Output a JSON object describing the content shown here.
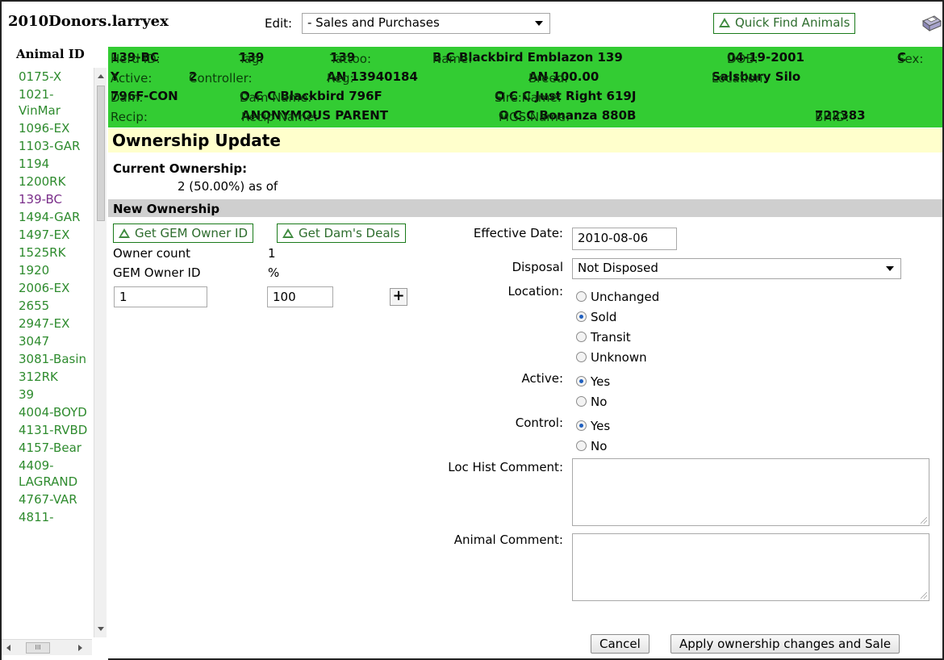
{
  "window": {
    "title": "2010Donors.larryex"
  },
  "toolbar": {
    "edit_label": "Edit:",
    "edit_value": "- Sales and Purchases",
    "quick_find_label": "Quick Find Animals"
  },
  "sidebar": {
    "header": "Animal ID",
    "items": [
      {
        "label": "0175-X"
      },
      {
        "label": "1021-VinMar"
      },
      {
        "label": "1096-EX"
      },
      {
        "label": "1103-GAR"
      },
      {
        "label": "1194"
      },
      {
        "label": "1200RK"
      },
      {
        "label": "139-BC"
      },
      {
        "label": "1494-GAR"
      },
      {
        "label": "1497-EX"
      },
      {
        "label": "1525RK"
      },
      {
        "label": "1920"
      },
      {
        "label": "2006-EX"
      },
      {
        "label": "2655"
      },
      {
        "label": "2947-EX"
      },
      {
        "label": "3047"
      },
      {
        "label": "3081-Basin"
      },
      {
        "label": "312RK"
      },
      {
        "label": "39"
      },
      {
        "label": "4004-BOYD"
      },
      {
        "label": "4131-RVBD"
      },
      {
        "label": "4157-Bear"
      },
      {
        "label": "4409-LAGRAND"
      },
      {
        "label": "4767-VAR"
      },
      {
        "label": "4811-"
      }
    ]
  },
  "animal": {
    "herd_id_label": "Herd ID:",
    "herd_id": "139-BC",
    "tag_label": "Tag:",
    "tag": "139",
    "tattoo_label": "Tattoo:",
    "tattoo": "139",
    "name_label": "Name:",
    "name": "B C Blackbird Emblazon 139",
    "dob_label": "DOB:",
    "dob": "04-19-2001",
    "sex_label": "Sex:",
    "sex": "C",
    "active_label": "Active:",
    "active": "Y",
    "controller_label": "Controller:",
    "controller": "2",
    "reg_label": "Reg:",
    "reg": "AN 13940184",
    "breed_label": "Breed:",
    "breed": "AN 100.00",
    "location_label": "Location:",
    "location": "Salsbury Silo",
    "dam_label": "Dam:",
    "dam": "796F-CON",
    "dam_name_label": "Dam Name:",
    "dam_name": "O C C Blackbird 796F",
    "sire_label": "Sire:",
    "sire_name_label": "Sire Name:",
    "sire_name": "O C C Just Right 619J",
    "recip_label": "Recip:",
    "recip_name_label": "Recip Name:",
    "recip_name": "ANONYMOUS PARENT",
    "mgs_label": "MGS:",
    "mgs_name_label": "MGS Name:",
    "mgs_name": "O C C Bonanza 880B",
    "bhid_label": "BHID:",
    "bhid": "722383"
  },
  "ownership": {
    "title": "Ownership Update",
    "current_label": "Current Ownership:",
    "current_value": "2 (50.00%) as of",
    "new_label": "New Ownership",
    "get_gem_owner_label": "Get GEM Owner ID",
    "get_dams_deals_label": "Get Dam's Deals",
    "owner_count_label": "Owner count",
    "owner_count": "1",
    "gem_owner_id_header": "GEM Owner ID",
    "percent_header": "%",
    "owner_id_value": "1",
    "percent_value": "100",
    "add_row_label": "+"
  },
  "form": {
    "effective_date_label": "Effective Date:",
    "effective_date": "2010-08-06",
    "disposal_label": "Disposal",
    "disposal_value": "Not Disposed",
    "location_label": "Location:",
    "location_options": [
      "Unchanged",
      "Sold",
      "Transit",
      "Unknown"
    ],
    "location_selected": "Sold",
    "active_label": "Active:",
    "active_options": [
      "Yes",
      "No"
    ],
    "active_selected": "Yes",
    "control_label": "Control:",
    "control_options": [
      "Yes",
      "No"
    ],
    "control_selected": "Yes",
    "loc_hist_comment_label": "Loc Hist Comment:",
    "animal_comment_label": "Animal Comment:",
    "cancel_label": "Cancel",
    "apply_label": "Apply ownership changes and Sale"
  },
  "icons": {
    "quick_find": "triangle-icon",
    "print": "printer-icon"
  },
  "colors": {
    "info_band": "#33cc33",
    "section_title_bg": "#ffffcc",
    "link_green": "#2e8b2e"
  }
}
